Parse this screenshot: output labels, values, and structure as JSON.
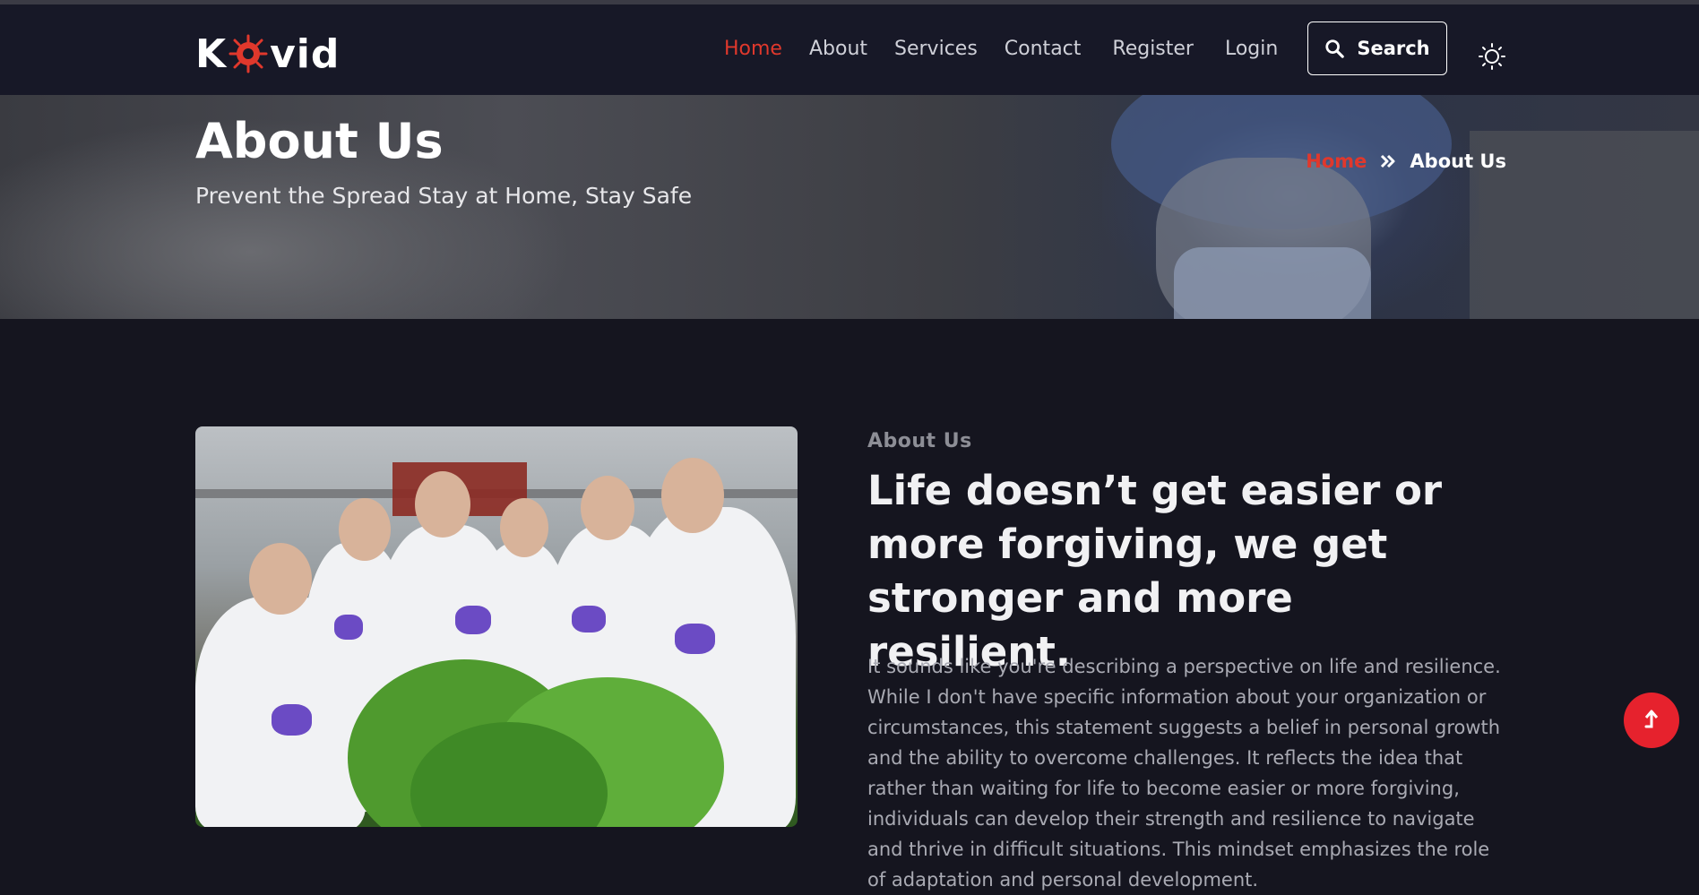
{
  "brand": {
    "logo_k": "K",
    "logo_rest": "vid",
    "accent": "#e0382c"
  },
  "nav": {
    "items": [
      {
        "label": "Home",
        "active": true
      },
      {
        "label": "About",
        "active": false
      },
      {
        "label": "Services",
        "active": false
      },
      {
        "label": "Contact",
        "active": false
      },
      {
        "label": "Register",
        "active": false
      },
      {
        "label": "Login",
        "active": false
      }
    ],
    "search_label": "Search",
    "search_icon": "search-icon",
    "theme_icon": "sun-icon"
  },
  "hero": {
    "title": "About Us",
    "subtitle": "Prevent the Spread Stay at Home, Stay Safe",
    "breadcrumb": {
      "home": "Home",
      "current": "About Us"
    }
  },
  "about": {
    "eyebrow": "About Us",
    "headline": "Life doesn’t get easier or more forgiving, we get stronger and more resilient.",
    "body": "It sounds like you're describing a perspective on life and resilience. While I don't have specific information about your organization or circumstances, this statement suggests a belief in personal growth and the ability to overcome challenges. It reflects the idea that rather than waiting for life to become easier or more forgiving, individuals can develop their strength and resilience to navigate and thrive in difficult situations. This mindset emphasizes the role of adaptation and personal development."
  },
  "scroll_top": {
    "icon": "arrow-up-icon",
    "color": "#e6222d"
  }
}
